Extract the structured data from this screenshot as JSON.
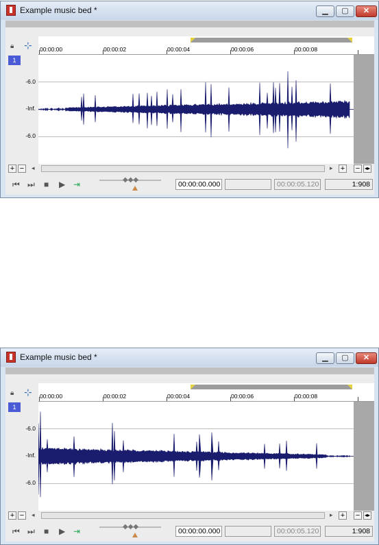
{
  "windows": [
    {
      "title": "Example music bed *",
      "ruler_labels": [
        "00:00:00",
        "00:00:02",
        "00:00:04",
        "00:00:06",
        "00:00:08"
      ],
      "channel": "1",
      "db_labels": [
        "-6.0",
        "-Inf.",
        "-6.0"
      ],
      "time_current": "00:00:00.000",
      "time_selection": "",
      "time_length": "00:00:05.120",
      "zoom_ratio": "1:908",
      "waveform": "ramp-up"
    },
    {
      "title": "Example music bed *",
      "ruler_labels": [
        "00:00:00",
        "00:00:02",
        "00:00:04",
        "00:00:06",
        "00:00:08"
      ],
      "channel": "1",
      "db_labels": [
        "-6.0",
        "-Inf.",
        "-6.0"
      ],
      "time_current": "00:00:00.000",
      "time_selection": "",
      "time_length": "00:00:05.120",
      "zoom_ratio": "1:908",
      "waveform": "ramp-down"
    }
  ],
  "icons": {
    "app": "sound-forge-icon",
    "minimize": "minimize-icon",
    "maximize": "maximize-icon",
    "close": "close-icon",
    "lock": "lock-icon",
    "snap": "snap-icon",
    "zoom_in": "plus-icon",
    "zoom_out": "minus-icon",
    "prev": "skip-back-icon",
    "next": "skip-forward-icon",
    "stop": "stop-icon",
    "play": "play-icon",
    "loop": "loop-icon"
  },
  "colors": {
    "waveform": "#1a1d6e",
    "channel_badge": "#4b5bd6",
    "loop_marker": "#e7d13a",
    "close_button": "#c0392b"
  }
}
